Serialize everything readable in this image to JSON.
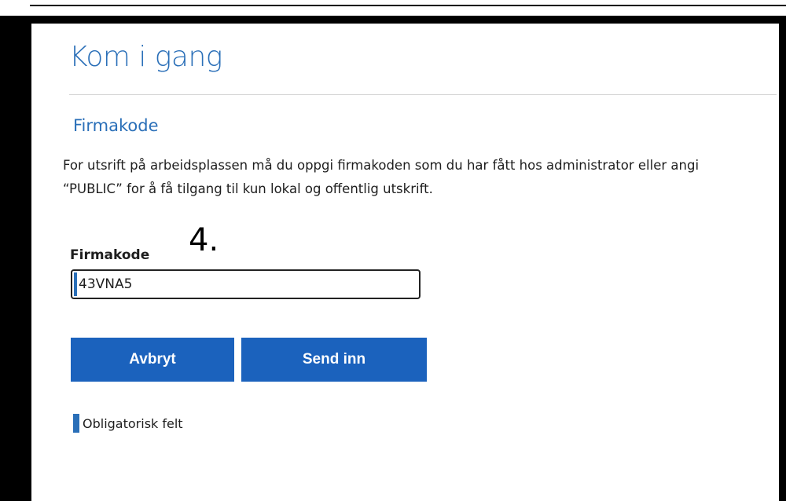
{
  "header": {
    "title": "Kom i gang"
  },
  "section": {
    "title": "Firmakode",
    "description": "For utsrift på arbeidsplassen må du oppgi firmakoden som du har fått hos administrator eller angi “PUBLIC” for å få tilgang til kun lokal og offentlig utskrift."
  },
  "annotation": {
    "step": "4."
  },
  "form": {
    "company_code_label": "Firmakode",
    "company_code_value": "43VNA5"
  },
  "actions": {
    "cancel_label": "Avbryt",
    "submit_label": "Send inn"
  },
  "footer": {
    "required_note": "Obligatorisk felt"
  },
  "colors": {
    "accent": "#2a6fb8",
    "button": "#1b62bd"
  }
}
